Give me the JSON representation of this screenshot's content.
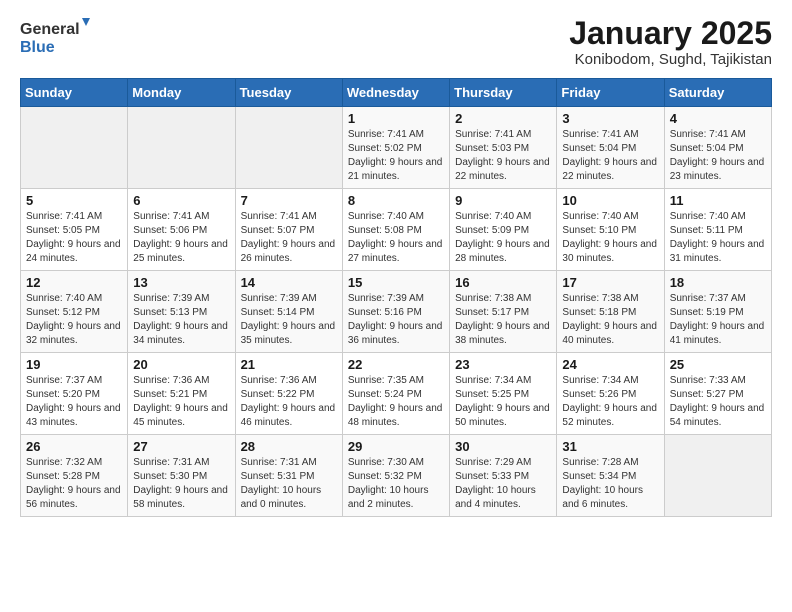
{
  "header": {
    "logo": {
      "general": "General",
      "blue": "Blue"
    },
    "title": "January 2025",
    "subtitle": "Konibodom, Sughd, Tajikistan"
  },
  "weekdays": [
    "Sunday",
    "Monday",
    "Tuesday",
    "Wednesday",
    "Thursday",
    "Friday",
    "Saturday"
  ],
  "weeks": [
    [
      {
        "day": "",
        "info": ""
      },
      {
        "day": "",
        "info": ""
      },
      {
        "day": "",
        "info": ""
      },
      {
        "day": "1",
        "info": "Sunrise: 7:41 AM\nSunset: 5:02 PM\nDaylight: 9 hours and 21 minutes."
      },
      {
        "day": "2",
        "info": "Sunrise: 7:41 AM\nSunset: 5:03 PM\nDaylight: 9 hours and 22 minutes."
      },
      {
        "day": "3",
        "info": "Sunrise: 7:41 AM\nSunset: 5:04 PM\nDaylight: 9 hours and 22 minutes."
      },
      {
        "day": "4",
        "info": "Sunrise: 7:41 AM\nSunset: 5:04 PM\nDaylight: 9 hours and 23 minutes."
      }
    ],
    [
      {
        "day": "5",
        "info": "Sunrise: 7:41 AM\nSunset: 5:05 PM\nDaylight: 9 hours and 24 minutes."
      },
      {
        "day": "6",
        "info": "Sunrise: 7:41 AM\nSunset: 5:06 PM\nDaylight: 9 hours and 25 minutes."
      },
      {
        "day": "7",
        "info": "Sunrise: 7:41 AM\nSunset: 5:07 PM\nDaylight: 9 hours and 26 minutes."
      },
      {
        "day": "8",
        "info": "Sunrise: 7:40 AM\nSunset: 5:08 PM\nDaylight: 9 hours and 27 minutes."
      },
      {
        "day": "9",
        "info": "Sunrise: 7:40 AM\nSunset: 5:09 PM\nDaylight: 9 hours and 28 minutes."
      },
      {
        "day": "10",
        "info": "Sunrise: 7:40 AM\nSunset: 5:10 PM\nDaylight: 9 hours and 30 minutes."
      },
      {
        "day": "11",
        "info": "Sunrise: 7:40 AM\nSunset: 5:11 PM\nDaylight: 9 hours and 31 minutes."
      }
    ],
    [
      {
        "day": "12",
        "info": "Sunrise: 7:40 AM\nSunset: 5:12 PM\nDaylight: 9 hours and 32 minutes."
      },
      {
        "day": "13",
        "info": "Sunrise: 7:39 AM\nSunset: 5:13 PM\nDaylight: 9 hours and 34 minutes."
      },
      {
        "day": "14",
        "info": "Sunrise: 7:39 AM\nSunset: 5:14 PM\nDaylight: 9 hours and 35 minutes."
      },
      {
        "day": "15",
        "info": "Sunrise: 7:39 AM\nSunset: 5:16 PM\nDaylight: 9 hours and 36 minutes."
      },
      {
        "day": "16",
        "info": "Sunrise: 7:38 AM\nSunset: 5:17 PM\nDaylight: 9 hours and 38 minutes."
      },
      {
        "day": "17",
        "info": "Sunrise: 7:38 AM\nSunset: 5:18 PM\nDaylight: 9 hours and 40 minutes."
      },
      {
        "day": "18",
        "info": "Sunrise: 7:37 AM\nSunset: 5:19 PM\nDaylight: 9 hours and 41 minutes."
      }
    ],
    [
      {
        "day": "19",
        "info": "Sunrise: 7:37 AM\nSunset: 5:20 PM\nDaylight: 9 hours and 43 minutes."
      },
      {
        "day": "20",
        "info": "Sunrise: 7:36 AM\nSunset: 5:21 PM\nDaylight: 9 hours and 45 minutes."
      },
      {
        "day": "21",
        "info": "Sunrise: 7:36 AM\nSunset: 5:22 PM\nDaylight: 9 hours and 46 minutes."
      },
      {
        "day": "22",
        "info": "Sunrise: 7:35 AM\nSunset: 5:24 PM\nDaylight: 9 hours and 48 minutes."
      },
      {
        "day": "23",
        "info": "Sunrise: 7:34 AM\nSunset: 5:25 PM\nDaylight: 9 hours and 50 minutes."
      },
      {
        "day": "24",
        "info": "Sunrise: 7:34 AM\nSunset: 5:26 PM\nDaylight: 9 hours and 52 minutes."
      },
      {
        "day": "25",
        "info": "Sunrise: 7:33 AM\nSunset: 5:27 PM\nDaylight: 9 hours and 54 minutes."
      }
    ],
    [
      {
        "day": "26",
        "info": "Sunrise: 7:32 AM\nSunset: 5:28 PM\nDaylight: 9 hours and 56 minutes."
      },
      {
        "day": "27",
        "info": "Sunrise: 7:31 AM\nSunset: 5:30 PM\nDaylight: 9 hours and 58 minutes."
      },
      {
        "day": "28",
        "info": "Sunrise: 7:31 AM\nSunset: 5:31 PM\nDaylight: 10 hours and 0 minutes."
      },
      {
        "day": "29",
        "info": "Sunrise: 7:30 AM\nSunset: 5:32 PM\nDaylight: 10 hours and 2 minutes."
      },
      {
        "day": "30",
        "info": "Sunrise: 7:29 AM\nSunset: 5:33 PM\nDaylight: 10 hours and 4 minutes."
      },
      {
        "day": "31",
        "info": "Sunrise: 7:28 AM\nSunset: 5:34 PM\nDaylight: 10 hours and 6 minutes."
      },
      {
        "day": "",
        "info": ""
      }
    ]
  ],
  "colors": {
    "header_bg": "#2a6db5",
    "header_text": "#ffffff",
    "logo_blue": "#2a6db5"
  }
}
